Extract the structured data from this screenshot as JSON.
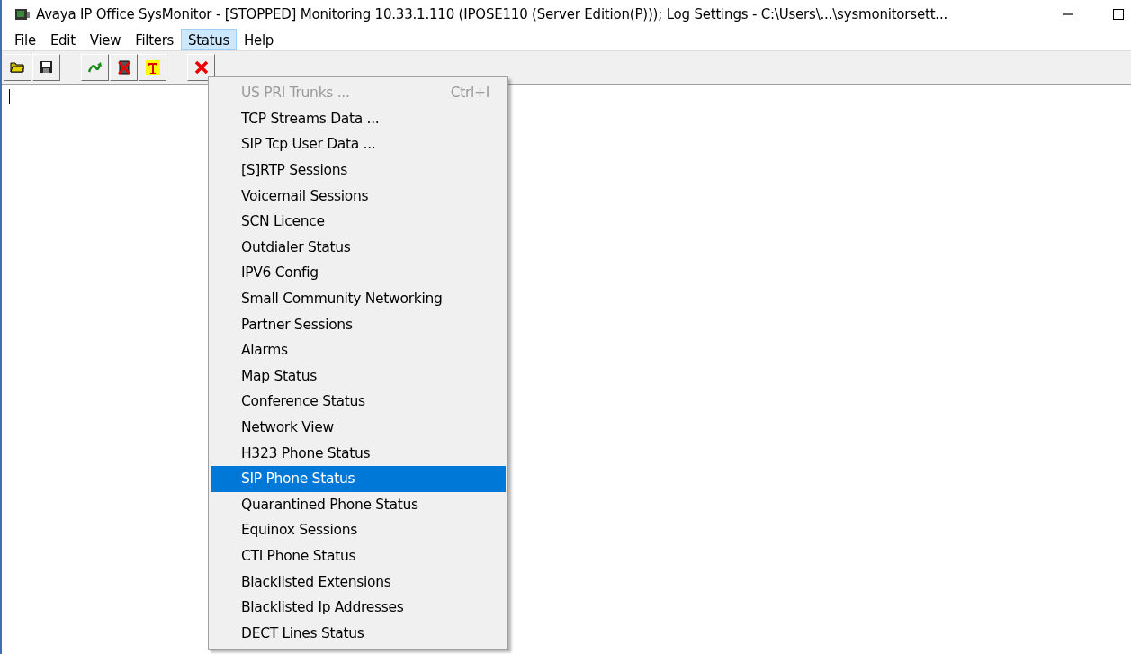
{
  "window": {
    "title": "Avaya IP Office SysMonitor - [STOPPED] Monitoring 10.33.1.110 (IPOSE110 (Server Edition(P))); Log Settings - C:\\Users\\...\\sysmonitorsett..."
  },
  "menu_bar": [
    {
      "label": "File",
      "selected": false
    },
    {
      "label": "Edit",
      "selected": false
    },
    {
      "label": "View",
      "selected": false
    },
    {
      "label": "Filters",
      "selected": false
    },
    {
      "label": "Status",
      "selected": true
    },
    {
      "label": "Help",
      "selected": false
    }
  ],
  "toolbar": [
    {
      "kind": "open"
    },
    {
      "kind": "save"
    },
    {
      "kind": "gap"
    },
    {
      "kind": "start"
    },
    {
      "kind": "clear"
    },
    {
      "kind": "trace"
    },
    {
      "kind": "gap"
    },
    {
      "kind": "stop"
    }
  ],
  "status_menu": [
    {
      "label": "US PRI Trunks ...",
      "shortcut": "Ctrl+I",
      "disabled": true,
      "selected": false
    },
    {
      "label": "TCP Streams Data ...",
      "disabled": false,
      "selected": false
    },
    {
      "label": "SIP Tcp User Data ...",
      "disabled": false,
      "selected": false
    },
    {
      "label": "[S]RTP Sessions",
      "disabled": false,
      "selected": false
    },
    {
      "label": "Voicemail Sessions",
      "disabled": false,
      "selected": false
    },
    {
      "label": "SCN Licence",
      "disabled": false,
      "selected": false
    },
    {
      "label": "Outdialer Status",
      "disabled": false,
      "selected": false
    },
    {
      "label": "IPV6 Config",
      "disabled": false,
      "selected": false
    },
    {
      "label": "Small Community Networking",
      "disabled": false,
      "selected": false
    },
    {
      "label": "Partner Sessions",
      "disabled": false,
      "selected": false
    },
    {
      "label": "Alarms",
      "disabled": false,
      "selected": false
    },
    {
      "label": "Map Status",
      "disabled": false,
      "selected": false
    },
    {
      "label": "Conference Status",
      "disabled": false,
      "selected": false
    },
    {
      "label": "Network View",
      "disabled": false,
      "selected": false
    },
    {
      "label": "H323 Phone Status",
      "disabled": false,
      "selected": false
    },
    {
      "label": "SIP Phone Status",
      "disabled": false,
      "selected": true
    },
    {
      "label": "Quarantined Phone Status",
      "disabled": false,
      "selected": false
    },
    {
      "label": "Equinox Sessions",
      "disabled": false,
      "selected": false
    },
    {
      "label": "CTI Phone Status",
      "disabled": false,
      "selected": false
    },
    {
      "label": "Blacklisted Extensions",
      "disabled": false,
      "selected": false
    },
    {
      "label": "Blacklisted Ip Addresses",
      "disabled": false,
      "selected": false
    },
    {
      "label": "DECT Lines Status",
      "disabled": false,
      "selected": false
    }
  ]
}
